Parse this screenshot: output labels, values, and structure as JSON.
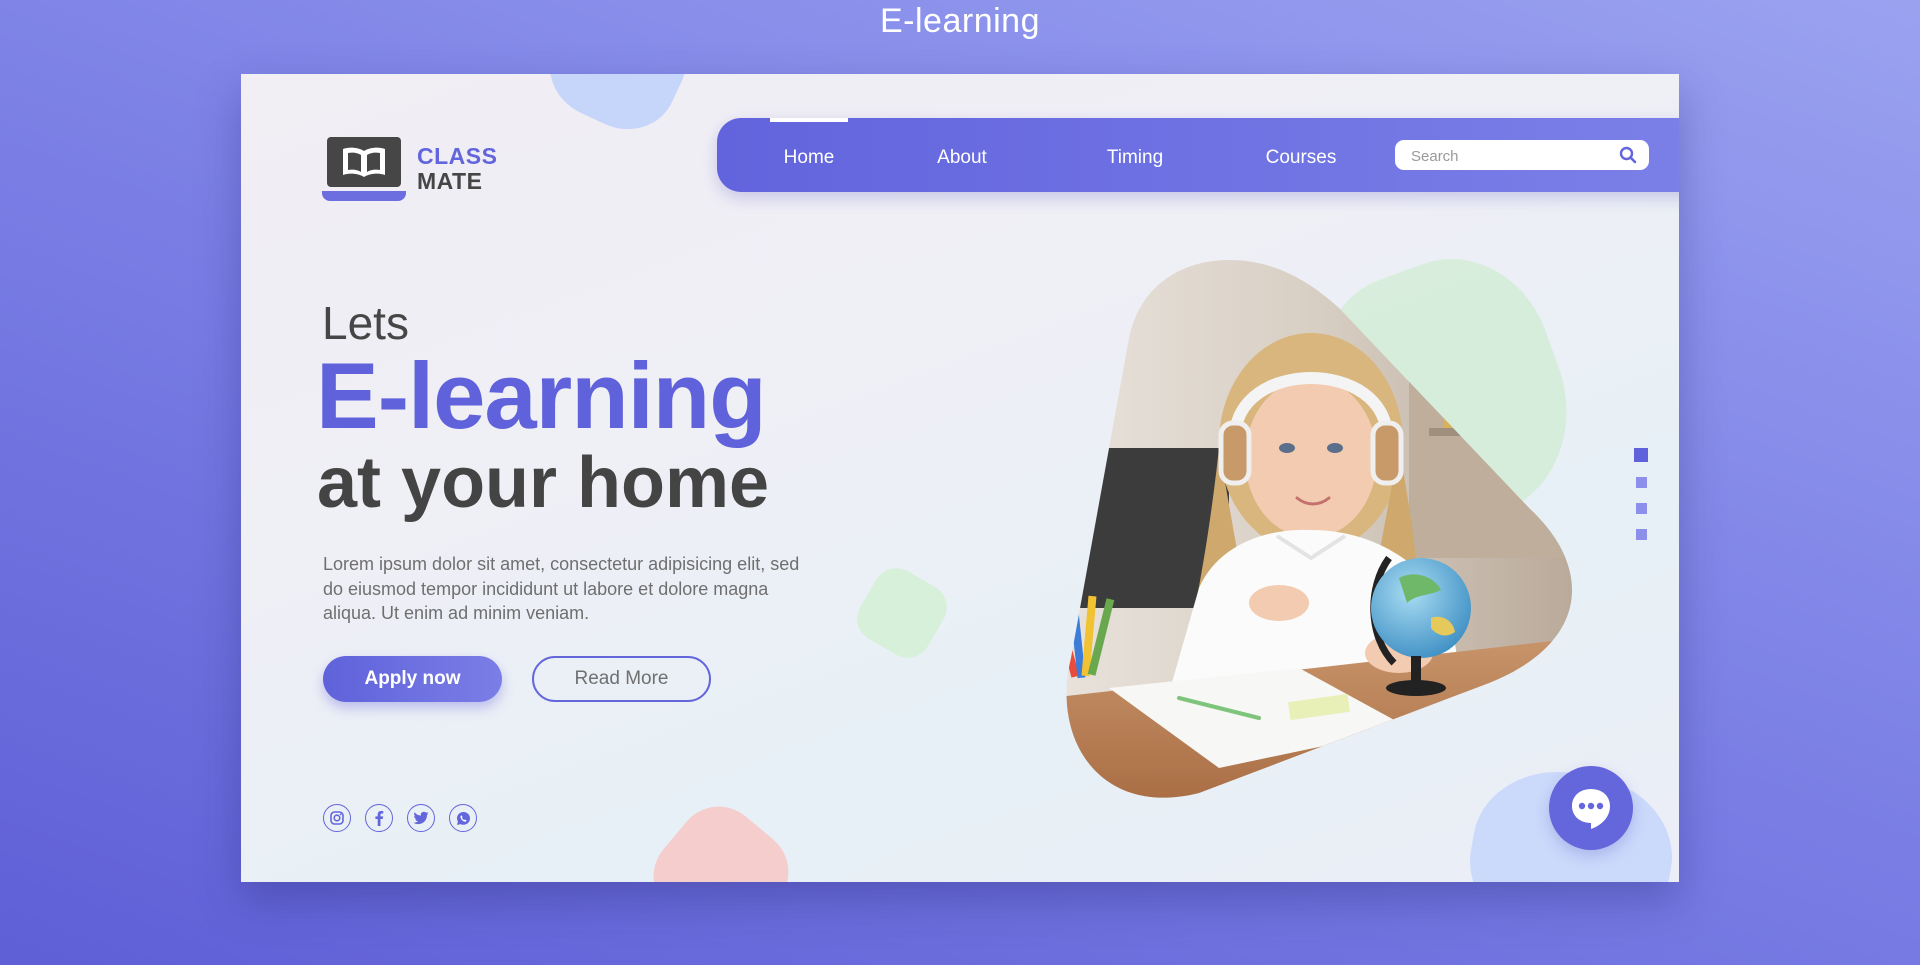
{
  "page": {
    "caption": "E-learning"
  },
  "brand": {
    "line1": "CLASS",
    "line2": "MATE"
  },
  "nav": {
    "items": [
      {
        "label": "Home",
        "active": true
      },
      {
        "label": "About",
        "active": false
      },
      {
        "label": "Timing",
        "active": false
      },
      {
        "label": "Courses",
        "active": false
      }
    ],
    "search_placeholder": "Search"
  },
  "hero": {
    "pre_title": "Lets",
    "title": "E-learning",
    "subtitle": "at your home",
    "body": "Lorem ipsum dolor sit amet, consectetur adipisicing elit, sed do eiusmod tempor incididunt ut labore et dolore magna aliqua. Ut enim ad minim veniam.",
    "primary_button": "Apply now",
    "secondary_button": "Read More"
  },
  "social": {
    "icons": [
      "instagram-icon",
      "facebook-icon",
      "twitter-icon",
      "whatsapp-icon"
    ]
  },
  "slider": {
    "dot_count": 4,
    "active_index": 0
  },
  "colors": {
    "accent": "#6265dc",
    "dark_text": "#464646",
    "body_text": "#6f6f6f"
  }
}
